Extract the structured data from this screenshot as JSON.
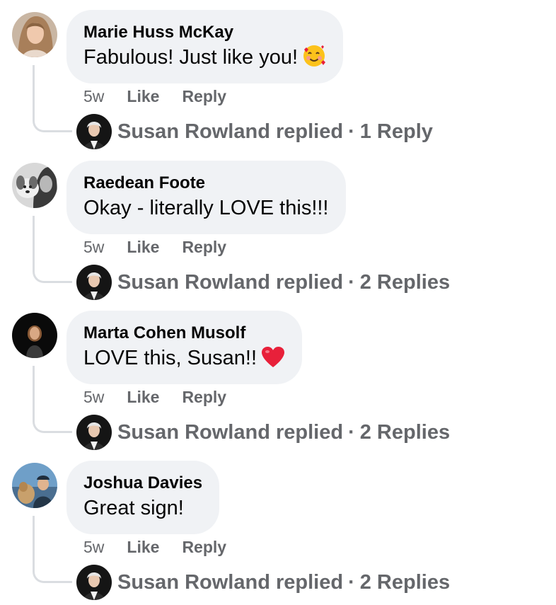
{
  "comments": [
    {
      "author": "Marie Huss McKay",
      "text": "Fabulous! Just like you!",
      "emoji": "smiling-face-with-hearts-icon",
      "time": "5w",
      "like_label": "Like",
      "reply_label": "Reply",
      "replier": "Susan Rowland replied",
      "separator": "·",
      "reply_count": "1 Reply"
    },
    {
      "author": "Raedean Foote",
      "text": "Okay - literally LOVE this!!!",
      "emoji": "",
      "time": "5w",
      "like_label": "Like",
      "reply_label": "Reply",
      "replier": "Susan Rowland replied",
      "separator": "·",
      "reply_count": "2 Replies"
    },
    {
      "author": "Marta Cohen Musolf",
      "text": "LOVE this, Susan!!",
      "emoji": "red-heart-icon",
      "time": "5w",
      "like_label": "Like",
      "reply_label": "Reply",
      "replier": "Susan Rowland replied",
      "separator": "·",
      "reply_count": "2 Replies"
    },
    {
      "author": "Joshua Davies",
      "text": "Great sign!",
      "emoji": "",
      "time": "5w",
      "like_label": "Like",
      "reply_label": "Reply",
      "replier": "Susan Rowland replied",
      "separator": "·",
      "reply_count": "2 Replies"
    }
  ],
  "colors": {
    "bubble": "#f0f2f5",
    "text": "#050505",
    "secondary": "#65676b",
    "connector": "#dadde1",
    "heart": "#e8203a"
  }
}
